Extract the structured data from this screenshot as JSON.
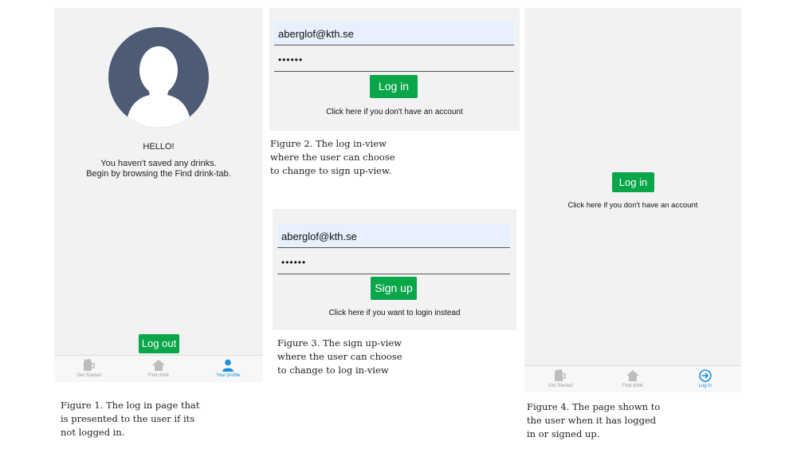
{
  "figure1": {
    "greeting": "HELLO!",
    "message_line1": "You haven't saved any drinks.",
    "message_line2": "Begin by browsing the Find drink-tab.",
    "logout_label": "Log out",
    "tabs": [
      {
        "label": "Get Started",
        "icon": "mug-icon"
      },
      {
        "label": "Find drink",
        "icon": "home-icon"
      },
      {
        "label": "Your profile",
        "icon": "person-icon"
      }
    ],
    "caption": "Figure 1. The log in page that\nis presented to the user if its\nnot logged in."
  },
  "figure2": {
    "email_value": "aberglof@kth.se",
    "password_value": "••••••",
    "button_label": "Log in",
    "switch_text": "Click here if you don't have an account",
    "caption": "Figure 2. The log in-view\nwhere the user can choose\nto change to sign up-view."
  },
  "figure3": {
    "email_value": "aberglof@kth.se",
    "password_value": "••••••",
    "button_label": "Sign up",
    "switch_text": "Click here if you want to login instead",
    "caption": "Figure 3. The sign up-view\nwhere the user can choose\nto change to log in-view"
  },
  "figure4": {
    "button_label": "Log in",
    "switch_text": "Click here if you don't have an account",
    "tabs": [
      {
        "label": "Get Started",
        "icon": "mug-icon"
      },
      {
        "label": "Find drink",
        "icon": "home-icon"
      },
      {
        "label": "Log in",
        "icon": "login-icon"
      }
    ],
    "caption": "Figure 4. The page shown to\nthe user when it has logged\nin or signed up."
  },
  "colors": {
    "accent_green": "#0aa64a",
    "active_tab_blue": "#1b8fe0",
    "avatar_bg": "#4d5b74",
    "input_highlight": "#e8effd"
  }
}
